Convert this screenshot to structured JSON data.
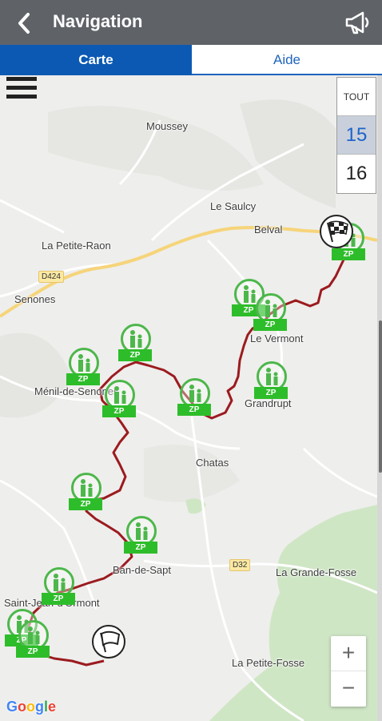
{
  "header": {
    "title": "Navigation",
    "back_icon": "chevron-left-icon",
    "announce_icon": "megaphone-icon"
  },
  "tabs": [
    {
      "label": "Carte",
      "active": true
    },
    {
      "label": "Aide",
      "active": false
    }
  ],
  "colors": {
    "header_bg": "#5f6368",
    "tab_active": "#0b59b3",
    "route": "#9b1b1f",
    "marker_green": "#2ebd2a",
    "forest": "#cfe6c5"
  },
  "map": {
    "places": [
      "Moussey",
      "Le Saulcy",
      "Belval",
      "La Petite-Raon",
      "Senones",
      "Le Vermont",
      "Ménil-de-Senones",
      "Grandrupt",
      "Chatas",
      "Ban-de-Sapt",
      "La Grande-Fosse",
      "Saint-Jean-d'Ormont",
      "La Petite-Fosse"
    ],
    "roads": [
      "D424",
      "D32"
    ],
    "marker_label": "ZP",
    "marker_icon": "family-icon",
    "start_icon": "flag-icon",
    "finish_icon": "checkered-flag-icon",
    "attribution": [
      "G",
      "o",
      "o",
      "g",
      "l",
      "e"
    ]
  },
  "zoom_selector": {
    "all_label": "TOUT",
    "levels": [
      "15",
      "16"
    ],
    "selected": "15"
  },
  "zoom_controls": {
    "zoom_in": "+",
    "zoom_out": "−"
  }
}
